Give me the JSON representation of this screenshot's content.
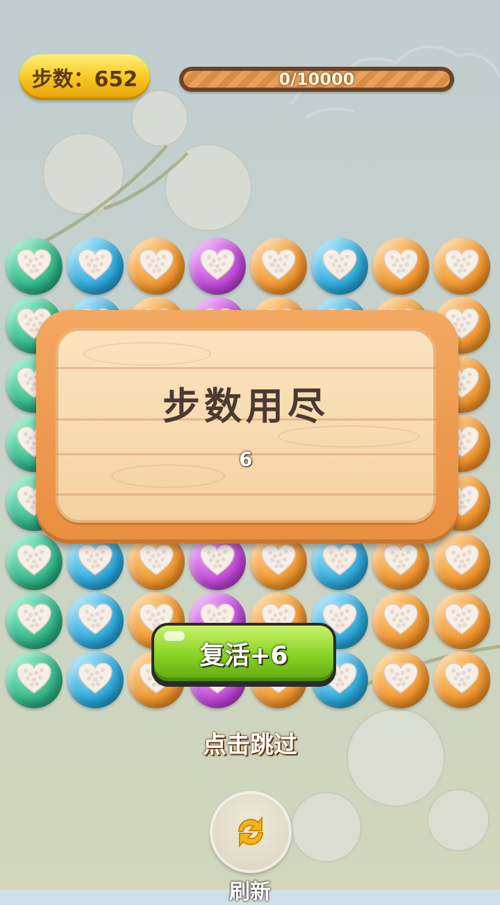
{
  "hud": {
    "steps_label": "步数：652",
    "progress_text": "0/10000",
    "progress_fraction": 0.0
  },
  "board": {
    "rows": [
      [
        "green",
        "blue",
        "orange",
        "purple",
        "orange",
        "blue",
        "orange",
        "orange"
      ],
      [
        "green",
        "blue",
        "orange",
        "purple",
        "orange",
        "blue",
        "orange",
        "orange"
      ],
      [
        "green",
        "blue",
        "orange",
        "purple",
        "orange",
        "blue",
        "orange",
        "orange"
      ],
      [
        "green",
        "blue",
        "orange",
        "purple",
        "orange",
        "blue",
        "orange",
        "orange"
      ],
      [
        "green",
        "blue",
        "orange",
        "purple",
        "orange",
        "blue",
        "orange",
        "orange"
      ],
      [
        "green",
        "blue",
        "orange",
        "purple",
        "orange",
        "blue",
        "orange",
        "orange"
      ],
      [
        "green",
        "blue",
        "orange",
        "purple",
        "orange",
        "blue",
        "orange",
        "orange"
      ],
      [
        "green",
        "blue",
        "orange",
        "purple",
        "orange",
        "blue",
        "orange",
        "orange"
      ]
    ],
    "gem_icon": "heart-icon"
  },
  "dialog": {
    "title": "步数用尽",
    "count": "6"
  },
  "revive_button": {
    "label": "复活+6"
  },
  "skip_link": {
    "label": "点击跳过"
  },
  "refresh_button": {
    "label": "刷新",
    "icon": "refresh-arrows-icon"
  },
  "colors": {
    "green": "#2fb487",
    "blue": "#2aa6d8",
    "orange": "#f0952c",
    "purple": "#c046d6",
    "button_green": "#86d224",
    "wood": "#f4d2a2"
  }
}
